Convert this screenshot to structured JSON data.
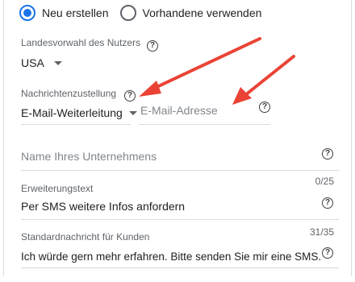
{
  "radio": {
    "option_new": "Neu erstellen",
    "option_existing": "Vorhandene verwenden",
    "selected": "option_new"
  },
  "country": {
    "label": "Landesvorwahl des Nutzers",
    "value": "USA"
  },
  "delivery": {
    "label": "Nachrichtenzustellung",
    "value": "E-Mail-Weiterleitung",
    "email_placeholder": "E-Mail-Adresse"
  },
  "business_name": {
    "placeholder": "Name Ihres Unternehmens"
  },
  "extension": {
    "label": "Erweiterungstext",
    "counter": "0/25",
    "value": "Per SMS weitere Infos anfordern"
  },
  "standard_message": {
    "label": "Standardnachricht für Kunden",
    "counter": "31/35",
    "value": "Ich würde gern mehr erfahren. Bitte senden Sie mir eine SMS."
  },
  "colors": {
    "accent": "#1a73e8",
    "annotation_arrow": "#ea4335"
  }
}
